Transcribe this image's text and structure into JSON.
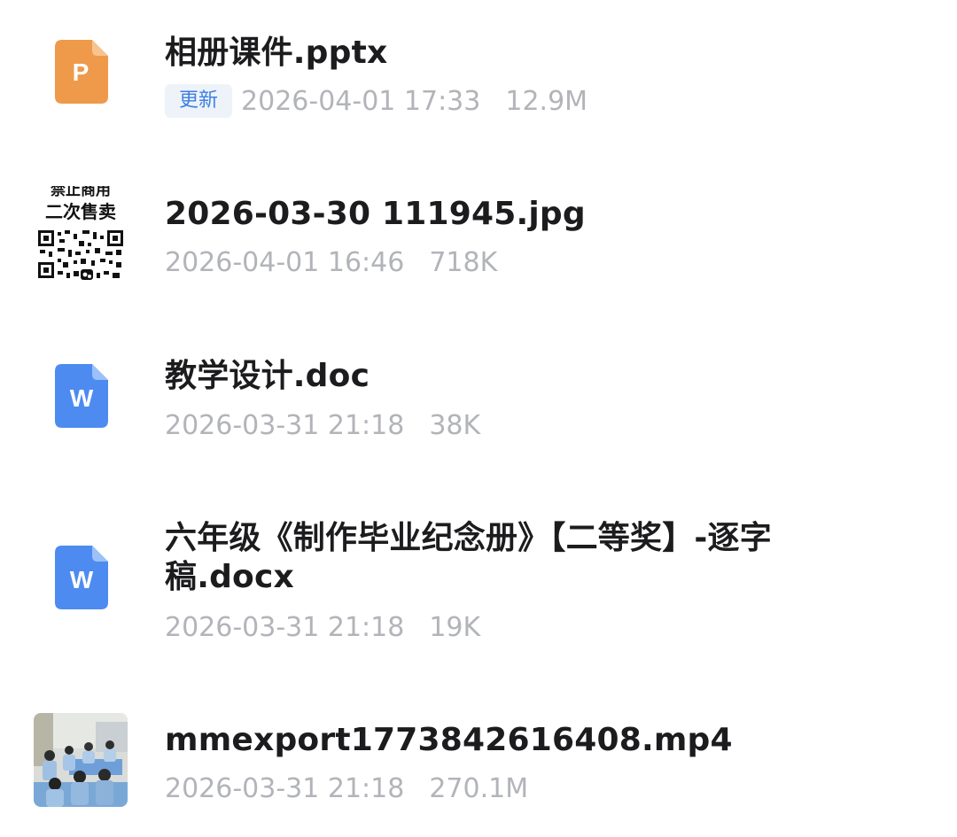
{
  "files": [
    {
      "name": "相册课件.pptx",
      "tag": "更新",
      "date": "2026-04-01 17:33",
      "size": "12.9M",
      "icon": "ppt-file-icon",
      "icon_letter": "P",
      "color": "#ee9a4a"
    },
    {
      "name": "2026-03-30 111945.jpg",
      "date": "2026-04-01 16:46",
      "size": "718K",
      "icon": "image-thumbnail",
      "thumb_text_top": "禁止商用",
      "thumb_text": "二次售卖"
    },
    {
      "name": "教学设计.doc",
      "date": "2026-03-31 21:18",
      "size": "38K",
      "icon": "word-file-icon",
      "icon_letter": "W",
      "color": "#4d8bf0"
    },
    {
      "name_line1": "六年级《制作毕业纪念册》【二等奖】-逐字",
      "name_line2": "稿.docx",
      "date": "2026-03-31 21:18",
      "size": "19K",
      "icon": "word-file-icon",
      "icon_letter": "W",
      "color": "#4d8bf0"
    },
    {
      "name": "mmexport1773842616408.mp4",
      "date": "2026-03-31 21:18",
      "size": "270.1M",
      "icon": "video-thumbnail"
    }
  ]
}
